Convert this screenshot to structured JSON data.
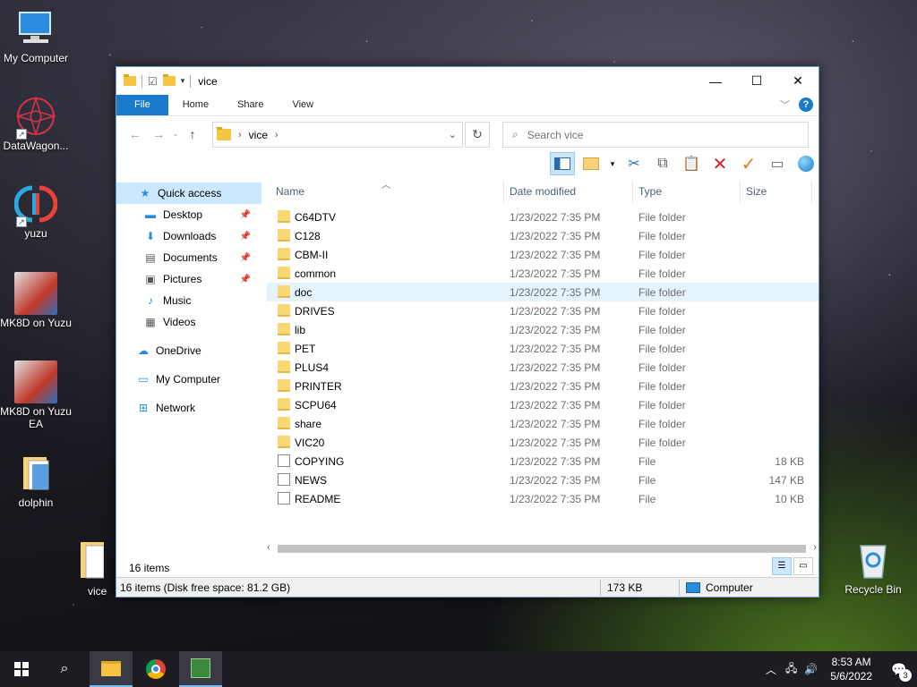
{
  "desktop": {
    "icons": [
      {
        "label": "My Computer",
        "icon": "computer-icon"
      },
      {
        "label": "DataWagon...",
        "icon": "datawagon-icon"
      },
      {
        "label": "yuzu",
        "icon": "yuzu-icon"
      },
      {
        "label": "MK8D on Yuzu",
        "icon": "mk8d-icon"
      },
      {
        "label": "MK8D on Yuzu EA",
        "icon": "mk8d-ea-icon"
      },
      {
        "label": "dolphin",
        "icon": "folder-icon"
      },
      {
        "label": "vice",
        "icon": "folder-icon"
      },
      {
        "label": "Recycle Bin",
        "icon": "recycle-bin-icon"
      }
    ]
  },
  "window": {
    "title": "vice",
    "controls": {
      "minimize": "—",
      "maximize": "☐",
      "close": "✕"
    }
  },
  "ribbon": {
    "tabs": [
      "File",
      "Home",
      "Share",
      "View"
    ]
  },
  "address": {
    "crumb": "vice",
    "search_placeholder": "Search vice"
  },
  "nav_pane": {
    "items": [
      {
        "label": "Quick access",
        "icon": "star-icon",
        "pinned": false
      },
      {
        "label": "Desktop",
        "icon": "desktop-icon",
        "pinned": true
      },
      {
        "label": "Downloads",
        "icon": "download-icon",
        "pinned": true
      },
      {
        "label": "Documents",
        "icon": "documents-icon",
        "pinned": true
      },
      {
        "label": "Pictures",
        "icon": "pictures-icon",
        "pinned": true
      },
      {
        "label": "Music",
        "icon": "music-icon",
        "pinned": false
      },
      {
        "label": "Videos",
        "icon": "videos-icon",
        "pinned": false
      },
      {
        "label": "OneDrive",
        "icon": "onedrive-icon",
        "pinned": false
      },
      {
        "label": "My Computer",
        "icon": "computer-icon",
        "pinned": false
      },
      {
        "label": "Network",
        "icon": "network-icon",
        "pinned": false
      }
    ]
  },
  "columns": {
    "name": "Name",
    "date": "Date modified",
    "type": "Type",
    "size": "Size"
  },
  "files": [
    {
      "name": "C64DTV",
      "date": "1/23/2022 7:35 PM",
      "type": "File folder",
      "size": "",
      "kind": "folder"
    },
    {
      "name": "C128",
      "date": "1/23/2022 7:35 PM",
      "type": "File folder",
      "size": "",
      "kind": "folder"
    },
    {
      "name": "CBM-II",
      "date": "1/23/2022 7:35 PM",
      "type": "File folder",
      "size": "",
      "kind": "folder"
    },
    {
      "name": "common",
      "date": "1/23/2022 7:35 PM",
      "type": "File folder",
      "size": "",
      "kind": "folder"
    },
    {
      "name": "doc",
      "date": "1/23/2022 7:35 PM",
      "type": "File folder",
      "size": "",
      "kind": "folder"
    },
    {
      "name": "DRIVES",
      "date": "1/23/2022 7:35 PM",
      "type": "File folder",
      "size": "",
      "kind": "folder"
    },
    {
      "name": "lib",
      "date": "1/23/2022 7:35 PM",
      "type": "File folder",
      "size": "",
      "kind": "folder"
    },
    {
      "name": "PET",
      "date": "1/23/2022 7:35 PM",
      "type": "File folder",
      "size": "",
      "kind": "folder"
    },
    {
      "name": "PLUS4",
      "date": "1/23/2022 7:35 PM",
      "type": "File folder",
      "size": "",
      "kind": "folder"
    },
    {
      "name": "PRINTER",
      "date": "1/23/2022 7:35 PM",
      "type": "File folder",
      "size": "",
      "kind": "folder"
    },
    {
      "name": "SCPU64",
      "date": "1/23/2022 7:35 PM",
      "type": "File folder",
      "size": "",
      "kind": "folder"
    },
    {
      "name": "share",
      "date": "1/23/2022 7:35 PM",
      "type": "File folder",
      "size": "",
      "kind": "folder"
    },
    {
      "name": "VIC20",
      "date": "1/23/2022 7:35 PM",
      "type": "File folder",
      "size": "",
      "kind": "folder"
    },
    {
      "name": "COPYING",
      "date": "1/23/2022 7:35 PM",
      "type": "File",
      "size": "18 KB",
      "kind": "file"
    },
    {
      "name": "NEWS",
      "date": "1/23/2022 7:35 PM",
      "type": "File",
      "size": "147 KB",
      "kind": "file"
    },
    {
      "name": "README",
      "date": "1/23/2022 7:35 PM",
      "type": "File",
      "size": "10 KB",
      "kind": "file"
    }
  ],
  "status": {
    "item_count": "16 items",
    "bar_left": "16 items (Disk free space: 81.2 GB)",
    "bar_size": "173 KB",
    "bar_location": "Computer"
  },
  "taskbar": {
    "time": "8:53 AM",
    "date": "5/6/2022",
    "notification_count": "3"
  },
  "colors": {
    "accent": "#1979ca",
    "selection": "#cce8ff",
    "hover_row": "#e5f3ff"
  }
}
